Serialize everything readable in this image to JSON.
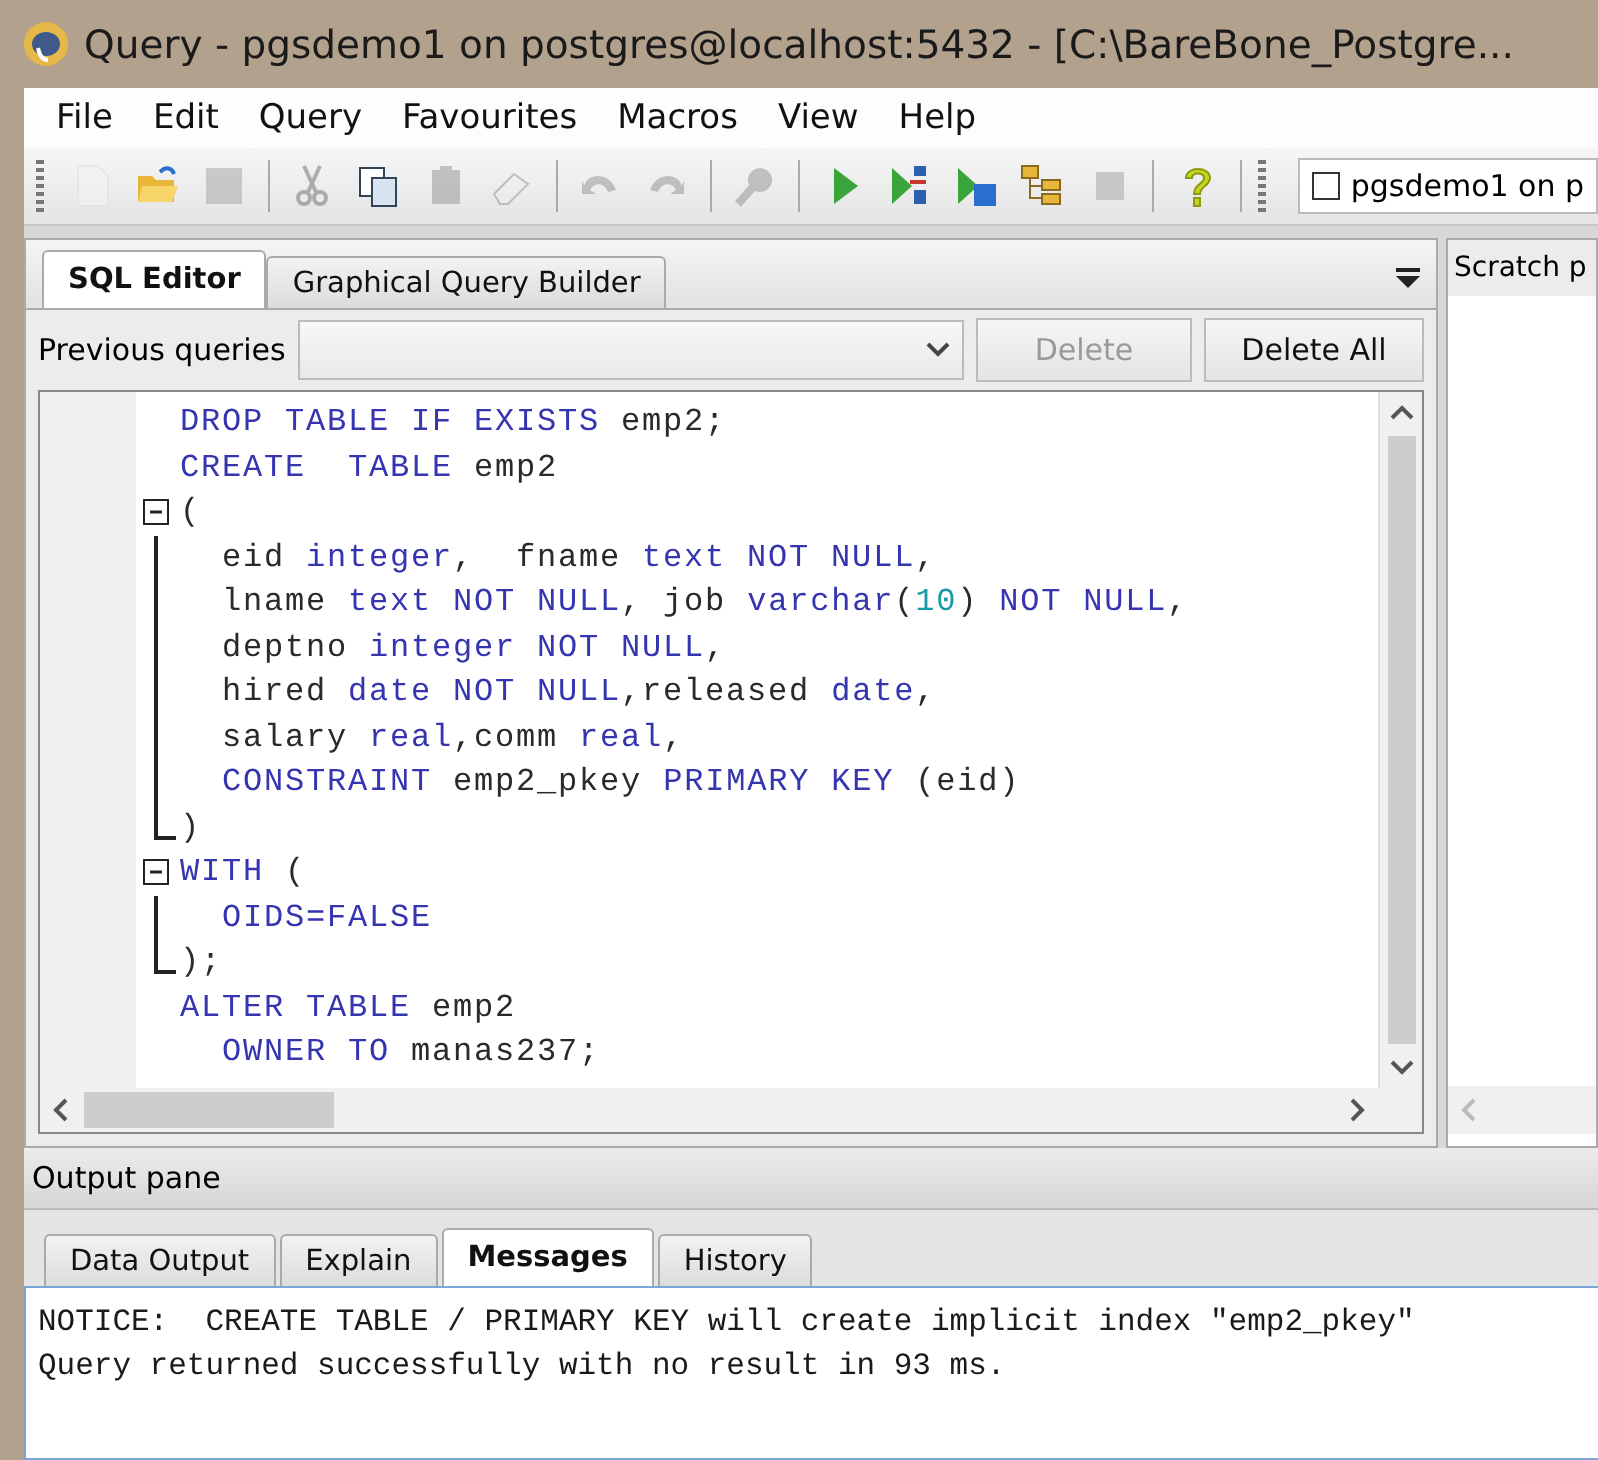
{
  "window": {
    "title": "Query - pgsdemo1 on postgres@localhost:5432 - [C:\\BareBone_Postgre..."
  },
  "menu": [
    "File",
    "Edit",
    "Query",
    "Favourites",
    "Macros",
    "View",
    "Help"
  ],
  "toolbar": {
    "tools": [
      {
        "kind": "new",
        "disabled": true
      },
      {
        "kind": "open",
        "disabled": false
      },
      {
        "kind": "save",
        "disabled": true
      },
      {
        "kind": "sep"
      },
      {
        "kind": "cut",
        "disabled": true
      },
      {
        "kind": "copy",
        "disabled": false
      },
      {
        "kind": "paste",
        "disabled": true
      },
      {
        "kind": "clear",
        "disabled": true
      },
      {
        "kind": "sep"
      },
      {
        "kind": "undo",
        "disabled": true
      },
      {
        "kind": "redo",
        "disabled": true
      },
      {
        "kind": "sep"
      },
      {
        "kind": "find",
        "disabled": true
      },
      {
        "kind": "sep"
      },
      {
        "kind": "run",
        "disabled": false
      },
      {
        "kind": "explain",
        "disabled": false
      },
      {
        "kind": "runfile",
        "disabled": false
      },
      {
        "kind": "analyze",
        "disabled": false
      },
      {
        "kind": "stop",
        "disabled": true
      },
      {
        "kind": "sep"
      },
      {
        "kind": "help",
        "disabled": false
      }
    ],
    "connection": {
      "label": "pgsdemo1 on p",
      "checked": false
    }
  },
  "editor_tabs": [
    {
      "label": "SQL Editor",
      "selected": true
    },
    {
      "label": "Graphical Query Builder",
      "selected": false
    }
  ],
  "previous_queries": {
    "label": "Previous queries",
    "buttons": [
      {
        "label": "Delete",
        "disabled": true
      },
      {
        "label": "Delete All",
        "disabled": false
      }
    ]
  },
  "code": [
    {
      "kind": "plain",
      "tokens": [
        {
          "kind": "kw",
          "text": "DROP TABLE IF EXISTS"
        },
        {
          "kind": "id",
          "text": " emp2;"
        }
      ]
    },
    {
      "kind": "plain",
      "tokens": [
        {
          "kind": "kw",
          "text": "CREATE  TABLE"
        },
        {
          "kind": "id",
          "text": " emp2"
        }
      ]
    },
    {
      "kind": "start",
      "tokens": [
        {
          "kind": "id",
          "text": "("
        }
      ]
    },
    {
      "kind": "body",
      "tokens": [
        {
          "kind": "id",
          "text": "  eid "
        },
        {
          "kind": "kw",
          "text": "integer"
        },
        {
          "kind": "id",
          "text": ",  fname "
        },
        {
          "kind": "kw",
          "text": "text NOT NULL"
        },
        {
          "kind": "id",
          "text": ","
        }
      ]
    },
    {
      "kind": "body",
      "tokens": [
        {
          "kind": "id",
          "text": "  lname "
        },
        {
          "kind": "kw",
          "text": "text NOT NULL"
        },
        {
          "kind": "id",
          "text": ", job "
        },
        {
          "kind": "kw",
          "text": "varchar"
        },
        {
          "kind": "id",
          "text": "("
        },
        {
          "kind": "num",
          "text": "10"
        },
        {
          "kind": "id",
          "text": ") "
        },
        {
          "kind": "kw",
          "text": "NOT NULL"
        },
        {
          "kind": "id",
          "text": ","
        }
      ]
    },
    {
      "kind": "body",
      "tokens": [
        {
          "kind": "id",
          "text": "  deptno "
        },
        {
          "kind": "kw",
          "text": "integer NOT NULL"
        },
        {
          "kind": "id",
          "text": ","
        }
      ]
    },
    {
      "kind": "body",
      "tokens": [
        {
          "kind": "id",
          "text": "  hired "
        },
        {
          "kind": "kw",
          "text": "date NOT NULL"
        },
        {
          "kind": "id",
          "text": ",released "
        },
        {
          "kind": "kw",
          "text": "date"
        },
        {
          "kind": "id",
          "text": ","
        }
      ]
    },
    {
      "kind": "body",
      "tokens": [
        {
          "kind": "id",
          "text": "  salary "
        },
        {
          "kind": "kw",
          "text": "real"
        },
        {
          "kind": "id",
          "text": ",comm "
        },
        {
          "kind": "kw",
          "text": "real"
        },
        {
          "kind": "id",
          "text": ","
        }
      ]
    },
    {
      "kind": "body",
      "tokens": [
        {
          "kind": "kw",
          "text": "  CONSTRAINT"
        },
        {
          "kind": "id",
          "text": " emp2_pkey "
        },
        {
          "kind": "kw",
          "text": "PRIMARY KEY"
        },
        {
          "kind": "id",
          "text": " (eid)"
        }
      ]
    },
    {
      "kind": "end",
      "tokens": [
        {
          "kind": "id",
          "text": ")"
        }
      ]
    },
    {
      "kind": "start",
      "tokens": [
        {
          "kind": "kw",
          "text": "WITH"
        },
        {
          "kind": "id",
          "text": " ("
        }
      ]
    },
    {
      "kind": "body",
      "tokens": [
        {
          "kind": "kw",
          "text": "  OIDS=FALSE"
        }
      ]
    },
    {
      "kind": "end",
      "tokens": [
        {
          "kind": "id",
          "text": ");"
        }
      ]
    },
    {
      "kind": "plain",
      "tokens": [
        {
          "kind": "kw",
          "text": "ALTER TABLE"
        },
        {
          "kind": "id",
          "text": " emp2"
        }
      ]
    },
    {
      "kind": "plain",
      "tokens": [
        {
          "kind": "kw",
          "text": "  OWNER TO"
        },
        {
          "kind": "id",
          "text": " manas237;"
        }
      ]
    }
  ],
  "scratch_pad": {
    "title": "Scratch p"
  },
  "output_pane": {
    "title": "Output pane",
    "tabs": [
      {
        "label": "Data Output",
        "selected": false
      },
      {
        "label": "Explain",
        "selected": false
      },
      {
        "label": "Messages",
        "selected": true
      },
      {
        "label": "History",
        "selected": false
      }
    ],
    "messages": [
      "NOTICE:  CREATE TABLE / PRIMARY KEY will create implicit index \"emp2_pkey\"",
      "Query returned successfully with no result in 93 ms."
    ]
  }
}
